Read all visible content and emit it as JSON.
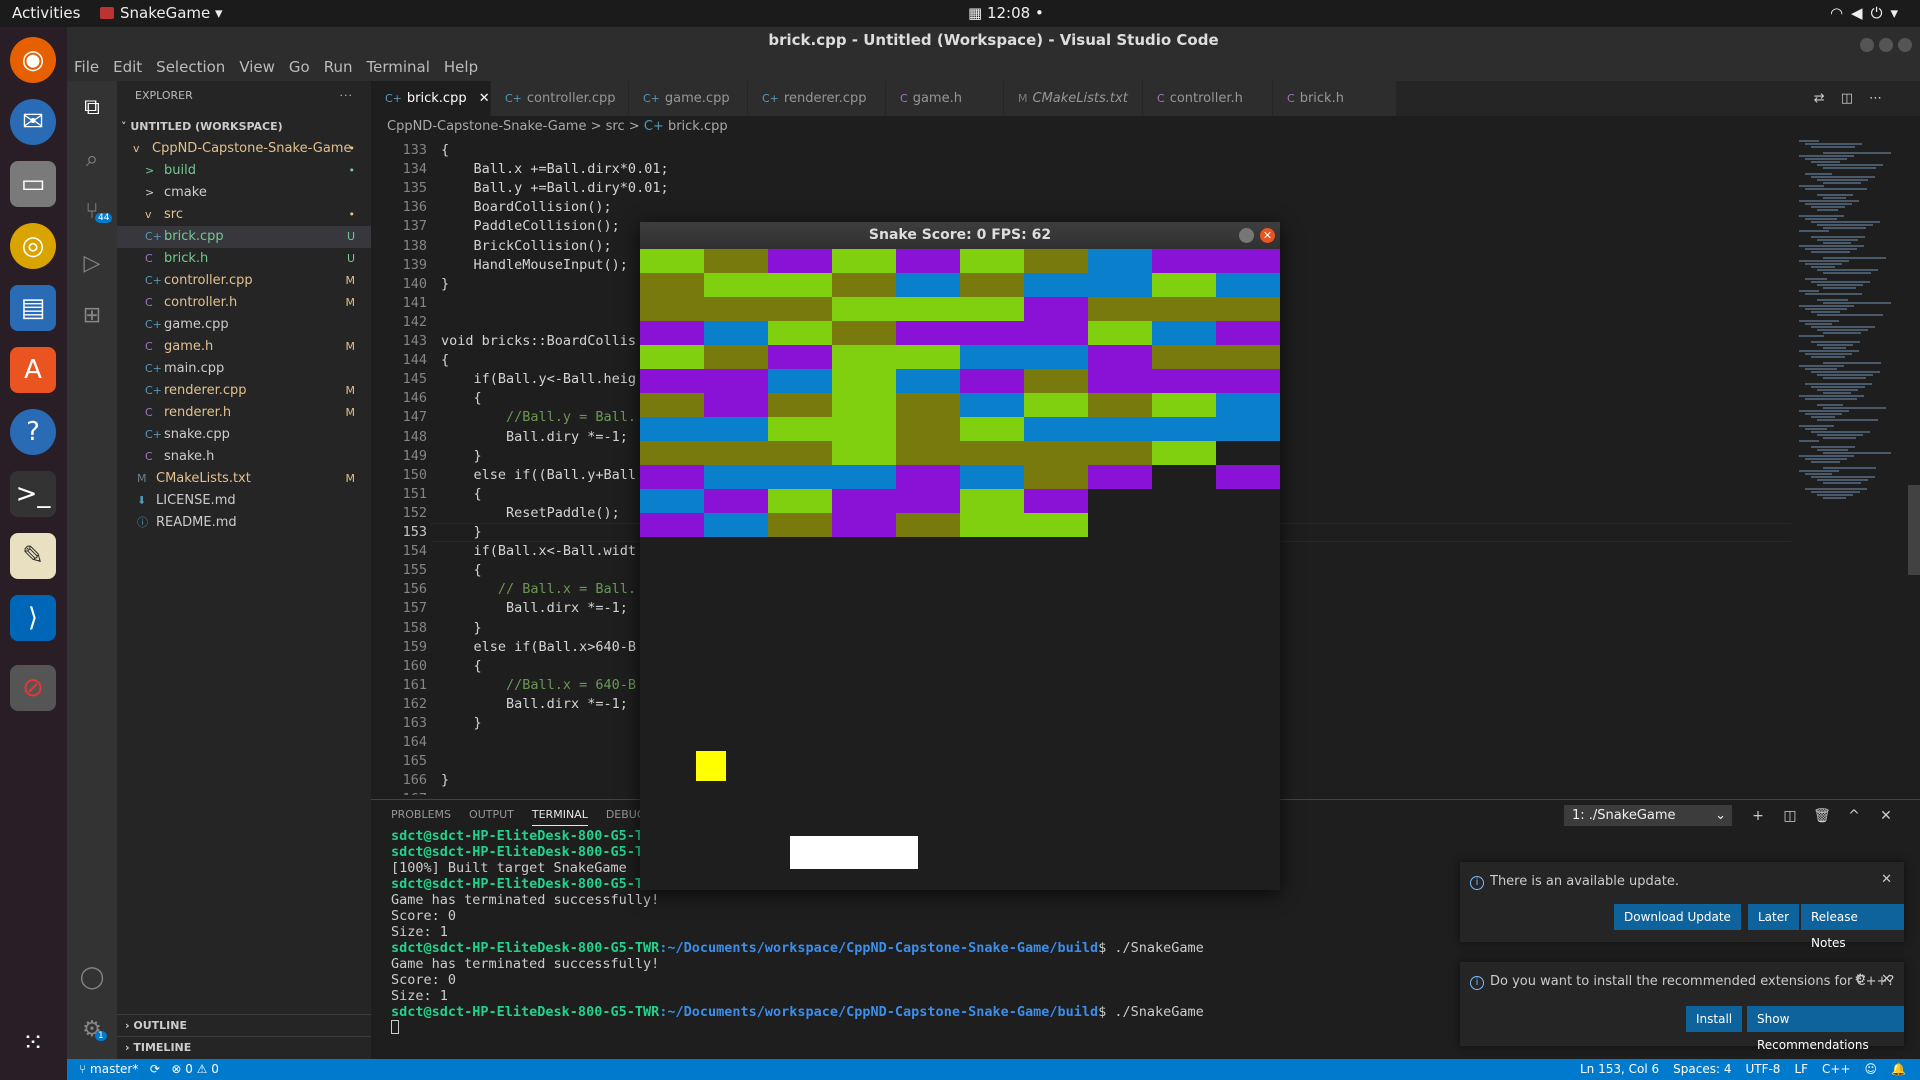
{
  "topbar": {
    "activities": "Activities",
    "app_name": "SnakeGame",
    "clock": "12:08"
  },
  "window": {
    "title": "brick.cpp - Untitled (Workspace) - Visual Studio Code"
  },
  "menu": [
    "File",
    "Edit",
    "Selection",
    "View",
    "Go",
    "Run",
    "Terminal",
    "Help"
  ],
  "activity_badge": "44",
  "settings_badge": "1",
  "explorer": {
    "header": "EXPLORER",
    "more": "···",
    "workspace": "UNTITLED (WORKSPACE)",
    "items": [
      {
        "label": "CppND-Capstone-Snake-Game",
        "icon": "v",
        "status": "•"
      },
      {
        "label": "build",
        "icon": ">",
        "status": "•"
      },
      {
        "label": "cmake",
        "icon": ">",
        "status": ""
      },
      {
        "label": "src",
        "icon": "v",
        "status": "•"
      },
      {
        "label": "brick.cpp",
        "icon": "C+",
        "status": "U"
      },
      {
        "label": "brick.h",
        "icon": "C",
        "status": "U"
      },
      {
        "label": "controller.cpp",
        "icon": "C+",
        "status": "M"
      },
      {
        "label": "controller.h",
        "icon": "C",
        "status": "M"
      },
      {
        "label": "game.cpp",
        "icon": "C+",
        "status": ""
      },
      {
        "label": "game.h",
        "icon": "C",
        "status": "M"
      },
      {
        "label": "main.cpp",
        "icon": "C+",
        "status": ""
      },
      {
        "label": "renderer.cpp",
        "icon": "C+",
        "status": "M"
      },
      {
        "label": "renderer.h",
        "icon": "C",
        "status": "M"
      },
      {
        "label": "snake.cpp",
        "icon": "C+",
        "status": ""
      },
      {
        "label": "snake.h",
        "icon": "C",
        "status": ""
      },
      {
        "label": "CMakeLists.txt",
        "icon": "M",
        "status": "M"
      },
      {
        "label": "LICENSE.md",
        "icon": "⬇",
        "status": ""
      },
      {
        "label": "README.md",
        "icon": "ⓘ",
        "status": ""
      }
    ],
    "outline": "OUTLINE",
    "timeline": "TIMELINE"
  },
  "tabs": [
    {
      "label": "brick.cpp",
      "icon": "C+",
      "close": "✕"
    },
    {
      "label": "controller.cpp",
      "icon": "C+"
    },
    {
      "label": "game.cpp",
      "icon": "C+"
    },
    {
      "label": "renderer.cpp",
      "icon": "C+"
    },
    {
      "label": "game.h",
      "icon": "C"
    },
    {
      "label": "CMakeLists.txt",
      "icon": "M"
    },
    {
      "label": "controller.h",
      "icon": "C"
    },
    {
      "label": "brick.h",
      "icon": "C"
    }
  ],
  "breadcrumb": {
    "folder": "CppND-Capstone-Snake-Game",
    "sep": ">",
    "sub": "src",
    "file": "brick.cpp"
  },
  "editor": {
    "lines": [
      {
        "n": "133",
        "t": "{"
      },
      {
        "n": "134",
        "t": "    Ball.x +=Ball.dirx*0.01;"
      },
      {
        "n": "135",
        "t": "    Ball.y +=Ball.diry*0.01;"
      },
      {
        "n": "136",
        "t": "    BoardCollision();"
      },
      {
        "n": "137",
        "t": "    PaddleCollision();"
      },
      {
        "n": "138",
        "t": "    BrickCollision();"
      },
      {
        "n": "139",
        "t": "    HandleMouseInput();"
      },
      {
        "n": "140",
        "t": "}"
      },
      {
        "n": "141",
        "t": ""
      },
      {
        "n": "142",
        "t": ""
      },
      {
        "n": "143",
        "t": "void bricks::BoardCollis"
      },
      {
        "n": "144",
        "t": "{"
      },
      {
        "n": "145",
        "t": "    if(Ball.y<-Ball.heig"
      },
      {
        "n": "146",
        "t": "    {"
      },
      {
        "n": "147",
        "t": "        //Ball.y = Ball."
      },
      {
        "n": "148",
        "t": "        Ball.diry *=-1;"
      },
      {
        "n": "149",
        "t": "    }"
      },
      {
        "n": "150",
        "t": "    else if((Ball.y+Ball"
      },
      {
        "n": "151",
        "t": "    {"
      },
      {
        "n": "152",
        "t": "        ResetPaddle();"
      },
      {
        "n": "153",
        "t": "    }"
      },
      {
        "n": "154",
        "t": "    if(Ball.x<-Ball.widt"
      },
      {
        "n": "155",
        "t": "    {"
      },
      {
        "n": "156",
        "t": "       // Ball.x = Ball."
      },
      {
        "n": "157",
        "t": "        Ball.dirx *=-1;"
      },
      {
        "n": "158",
        "t": "    }"
      },
      {
        "n": "159",
        "t": "    else if(Ball.x>640-B"
      },
      {
        "n": "160",
        "t": "    {"
      },
      {
        "n": "161",
        "t": "        //Ball.x = 640-B"
      },
      {
        "n": "162",
        "t": "        Ball.dirx *=-1;"
      },
      {
        "n": "163",
        "t": "    }"
      },
      {
        "n": "164",
        "t": ""
      },
      {
        "n": "165",
        "t": ""
      },
      {
        "n": "166",
        "t": "}"
      },
      {
        "n": "167",
        "t": ""
      }
    ]
  },
  "panel": {
    "tabs": [
      "PROBLEMS",
      "OUTPUT",
      "TERMINAL",
      "DEBUG"
    ],
    "terminal_select": "1: ./SnakeGame",
    "terminal_lines": [
      {
        "user": "sdct@sdct-HP-EliteDesk-800-G5-T",
        "path": "",
        "rest": ""
      },
      {
        "user": "sdct@sdct-HP-EliteDesk-800-G5-T",
        "path": "",
        "rest": ""
      },
      {
        "user": "",
        "path": "",
        "rest": "[100%] Built target SnakeGame"
      },
      {
        "user": "sdct@sdct-HP-EliteDesk-800-G5-T...",
        "path": "",
        "rest": ""
      },
      {
        "user": "",
        "path": "",
        "rest": "Game has terminated successfully!"
      },
      {
        "user": "",
        "path": "",
        "rest": "Score: 0"
      },
      {
        "user": "",
        "path": "",
        "rest": "Size: 1"
      },
      {
        "user": "sdct@sdct-HP-EliteDesk-800-G5-TWR",
        "path": ":~/Documents/workspace/CppND-Capstone-Snake-Game/build",
        "rest": "$ ./SnakeGame"
      },
      {
        "user": "",
        "path": "",
        "rest": "Game has terminated successfully!"
      },
      {
        "user": "",
        "path": "",
        "rest": "Score: 0"
      },
      {
        "user": "",
        "path": "",
        "rest": "Size: 1"
      },
      {
        "user": "sdct@sdct-HP-EliteDesk-800-G5-TWR",
        "path": ":~/Documents/workspace/CppND-Capstone-Snake-Game/build",
        "rest": "$ ./SnakeGame"
      }
    ]
  },
  "game_window": {
    "title": "Snake Score: 0 FPS: 62",
    "close": "✕",
    "colors": {
      "P": "#8a12d6",
      "O": "#787a0e",
      "G": "#80d010",
      "B": "#0a80cc"
    },
    "ball_color": "#ffff00",
    "paddle_color": "#ffffff",
    "brick_grid": [
      "GOPGPGOBPP",
      "OGGOBOBBGB",
      "OOOGGGPOOO",
      "PBGOPPPGBP",
      "GOPGGBBPOO",
      "PPBGBPOPPP",
      "OPOGOBGOGB",
      "BBGGOGBBBB",
      "OOOGOOOOG.",
      "PBBBPBOP.P",
      "BPGPPGP...",
      "PBOPOGG..."
    ]
  },
  "notifications": [
    {
      "message": "There is an available update.",
      "buttons": [
        "Download Update",
        "Later",
        "Release Notes"
      ]
    },
    {
      "message": "Do you want to install the recommended extensions for C++?",
      "buttons": [
        "Install",
        "Show Recommendations"
      ]
    }
  ],
  "status": {
    "branch": "master*",
    "sync": "⟳",
    "errors": "⊗ 0 ⚠ 0",
    "position": "Ln 153, Col 6",
    "spaces": "Spaces: 4",
    "encoding": "UTF-8",
    "eol": "LF",
    "language": "C++"
  }
}
